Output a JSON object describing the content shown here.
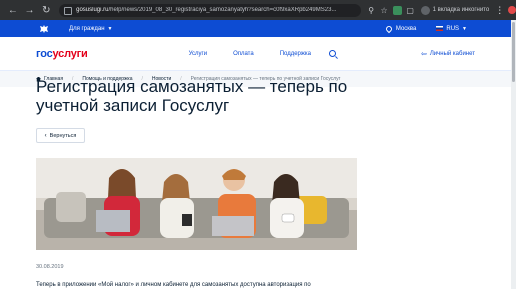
{
  "browser": {
    "url_host": "gosuslugi.ru",
    "url_path": "/help/news/2019_08_30_registraciya_samozanyatyh?search=c0f9xaXRpb249MS23...",
    "incognito_label": "1 вкладка инкогнито"
  },
  "topbar": {
    "for_who": "Для граждан",
    "city": "Москва",
    "lang": "RUS"
  },
  "header": {
    "logo_part1": "гос",
    "logo_part2": "услуги",
    "menu": [
      "Услуги",
      "Оплата",
      "Поддержка"
    ],
    "cabinet": "Личный кабинет"
  },
  "breadcrumbs": {
    "items": [
      "Главная",
      "Помощь и поддержка",
      "Новости"
    ],
    "current": "Регистрация самозанятых — теперь по учетной записи Госуслуг"
  },
  "article": {
    "title": "Регистрация самозанятых — теперь по учетной записи Госуслуг",
    "back_button": "Вернуться",
    "date": "30.08.2019",
    "lead": "Теперь в приложении «Мой налог» и личном кабинете для самозанятых доступна авторизация по"
  },
  "colors": {
    "brand_blue": "#0d4cd3",
    "brand_red": "#e3001b",
    "text_dark": "#0b1f33"
  }
}
